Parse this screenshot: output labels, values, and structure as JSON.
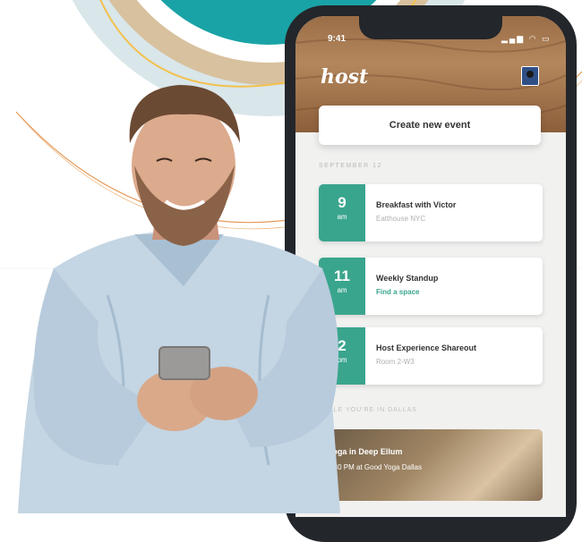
{
  "colors": {
    "accent": "#3aa58d",
    "header_wood": "#9a6d47",
    "phone_frame": "#23262b",
    "teal_circle": "#1aa3a6",
    "orange_arc": "#e59a5a"
  },
  "status_bar": {
    "time": "9:41",
    "icons": "▂▄▆ ◠ ▭"
  },
  "app": {
    "logo": "host",
    "avatar_icon": "profile-avatar-icon",
    "create_button": "Create new event",
    "section_label": "SEPTEMBER 12",
    "events": [
      {
        "hour": "9",
        "ampm": "am",
        "title": "Breakfast with Victor",
        "subtitle": "Eatthouse NYC"
      },
      {
        "hour": "11",
        "ampm": "am",
        "title": "Weekly Standup",
        "subtitle": "Find a space"
      },
      {
        "hour": "2",
        "ampm": "pm",
        "title": "Host Experience Shareout",
        "subtitle": "Room 2-W3"
      }
    ],
    "section_label2": "WHILE YOU'RE IN DALLAS",
    "promo": {
      "title": "Yoga in Deep Ellum",
      "subtitle": "6:30 PM at Good Yoga Dallas"
    }
  }
}
